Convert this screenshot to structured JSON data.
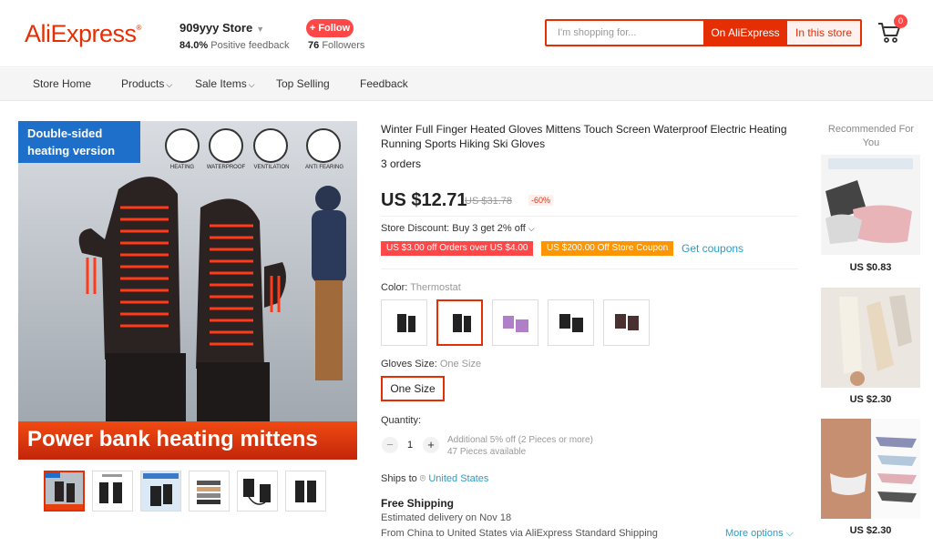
{
  "header": {
    "logo": "AliExpress",
    "store_name": "909yyy Store",
    "feedback_pct": "84.0%",
    "feedback_label": "Positive feedback",
    "follow_label": "+ Follow",
    "followers_count": "76",
    "followers_label": "Followers",
    "search_placeholder": "I'm shopping for...",
    "btn_on_aliexpress": "On AliExpress",
    "btn_in_store": "In this store",
    "cart_count": "0"
  },
  "nav": {
    "items": [
      "Store Home",
      "Products",
      "Sale Items",
      "Top Selling",
      "Feedback"
    ]
  },
  "product": {
    "image_badge": "Double-sided heating version",
    "image_features": [
      "HEATING",
      "WATERPROOF",
      "VENTILATION",
      "ANTI FEARING"
    ],
    "image_banner": "Power bank heating mittens",
    "title": "Winter Full Finger Heated Gloves Mittens Touch Screen Waterproof Electric Heating Running Sports Hiking Ski Gloves",
    "orders": "3 orders",
    "price": "US $12.71",
    "old_price": "US $31.78",
    "discount": "-60%",
    "store_discount": "Store Discount: Buy 3 get 2% off",
    "coupon1": "US $3.00 off Orders over US $4.00",
    "coupon2": "US $200.00 Off Store Coupon",
    "get_coupons": "Get coupons",
    "color_label": "Color:",
    "color_value": "Thermostat",
    "size_label": "Gloves Size:",
    "size_value": "One Size",
    "size_option": "One Size",
    "quantity_label": "Quantity:",
    "quantity": "1",
    "qty_note1": "Additional 5% off (2 Pieces or more)",
    "qty_note2": "47 Pieces available",
    "ships_to_label": "Ships to",
    "ships_to_country": "United States",
    "free_shipping": "Free Shipping",
    "estimated": "Estimated delivery on Nov 18",
    "from_text": "From China to United States via AliExpress Standard Shipping",
    "more_options": "More options"
  },
  "recommended": {
    "title": "Recommended For You",
    "items": [
      {
        "price": "US $0.83"
      },
      {
        "price": "US $2.30"
      },
      {
        "price": "US $2.30"
      }
    ]
  },
  "colors": {
    "brand": "#e62e04",
    "link": "#2e9cc3",
    "coupon_red": "#ff4747",
    "coupon_orange": "#ff9500"
  }
}
